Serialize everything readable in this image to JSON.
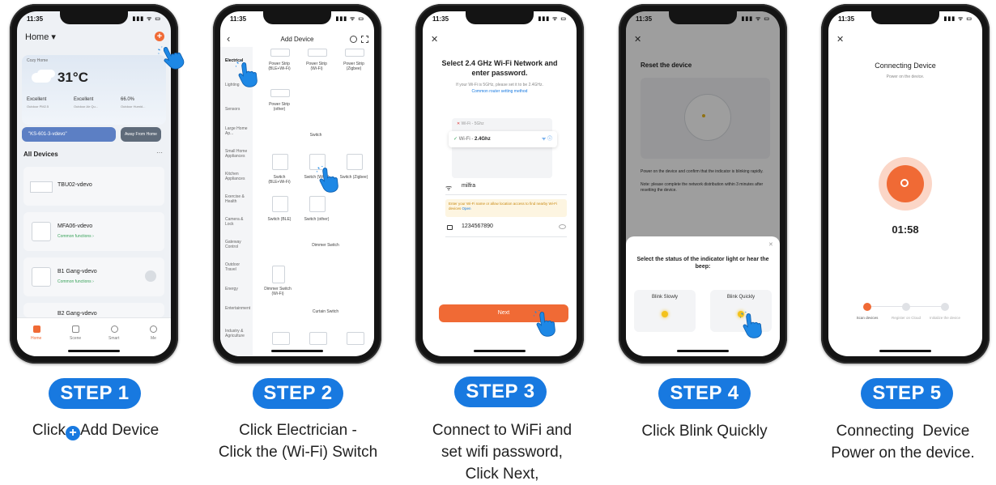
{
  "colors": {
    "accent": "#1879e0",
    "orange": "#f06a35",
    "hand": "#1e88e5"
  },
  "status": {
    "time": "11:35",
    "icons": "▮▮▮ ᯤ ▭"
  },
  "phone1": {
    "header": "Home ▾",
    "cozy": "Cozy Home",
    "temp": "31°C",
    "w1_val": "Excellent",
    "w1_lbl": "Outdoor PM2.5",
    "w2_val": "Excellent",
    "w2_lbl": "Outdoor Air Qu...",
    "w3_val": "66.0%",
    "w3_lbl": "Outdoor Humid...",
    "scene1": "\"KS-601-3-vdevo\"",
    "scene2": "Away From Home",
    "all_devices": "All Devices",
    "more": "···",
    "d1": "TBU02-vdevo",
    "d2": "MFA06-vdevo",
    "d2_sub": "Common functions ›",
    "d3": "B1 Gang-vdevo",
    "d3_sub": "Common functions ›",
    "d4": "B2 Gang-vdevo",
    "nav": [
      "Home",
      "Scene",
      "Smart",
      "Me"
    ]
  },
  "phone2": {
    "back": "‹",
    "title": "Add Device",
    "cats": [
      "Electrical",
      "Lighting",
      "Sensors",
      "Large Home Ap...",
      "Small Home Appliances",
      "Kitchen Appliances",
      "Exercise & Health",
      "Camera & Lock",
      "Gateway Control",
      "Outdoor Travel",
      "Energy",
      "Entertainment",
      "Industry & Agriculture"
    ],
    "p1": "Power Strip (BLE+Wi-Fi)",
    "p2": "Power Strip (Wi-Fi)",
    "p3": "Power Strip (Zigbee)",
    "p4": "Power Strip (other)",
    "sec_switch": "Switch",
    "s1": "Switch (BLE+Wi-Fi)",
    "s2": "Switch (Wi-Fi)",
    "s3": "Switch (Zigbee)",
    "s4": "Switch (BLE)",
    "s5": "Switch (other)",
    "sec_dimmer": "Dimmer Switch",
    "s6": "Dimmer Switch (Wi-Fi)",
    "sec_curtain": "Curtain Switch"
  },
  "phone3": {
    "close": "✕",
    "title": "Select 2.4 GHz Wi-Fi Network and enter password.",
    "sub": "If your Wi-Fi is 5GHz, please set it to be 2.4GHz.",
    "link": "Common router setting method",
    "w5": "Wi-Fi - 5Ghz",
    "w24a": "Wi-Fi -",
    "w24b": "2.4Ghz",
    "ssid": "milfra",
    "warn": "Enter your Wi-Fi name or allow location access to find nearby Wi-Fi devices",
    "warn_link": "Open",
    "pwd": "1234567890",
    "next": "Next"
  },
  "phone4": {
    "close": "✕",
    "title": "Reset the device",
    "text1": "Power on the device and confirm that the indicator is blinking rapidly.",
    "text2": "Note: please complete the network distribution within 3 minutes after resetting the device.",
    "sheet_close": "✕",
    "sheet_title": "Select the status of the indicator light or hear the beep:",
    "opt1": "Blink Slowly",
    "opt2": "Blink Quickly"
  },
  "phone5": {
    "close": "✕",
    "title": "Connecting Device",
    "sub": "Power on the device.",
    "timer": "01:58",
    "step1": "Scan devices",
    "step2": "Register on Cloud",
    "step3": "Initialize the device"
  },
  "steps": [
    {
      "label": "STEP 1",
      "caption_pre": "Click",
      "caption_post": "Add Device"
    },
    {
      "label": "STEP 2",
      "caption_l1": "Click Electrician -",
      "caption_l2": "Click the (Wi-Fi) Switch"
    },
    {
      "label": "STEP 3",
      "caption_l1": "Connect to WiFi and",
      "caption_l2": "set wifi password,",
      "caption_l3": "Click Next,"
    },
    {
      "label": "STEP 4",
      "caption_l1": "Click Blink Quickly"
    },
    {
      "label": "STEP 5",
      "caption_l1": "Connecting  Device",
      "caption_l2": "Power on the device."
    }
  ]
}
